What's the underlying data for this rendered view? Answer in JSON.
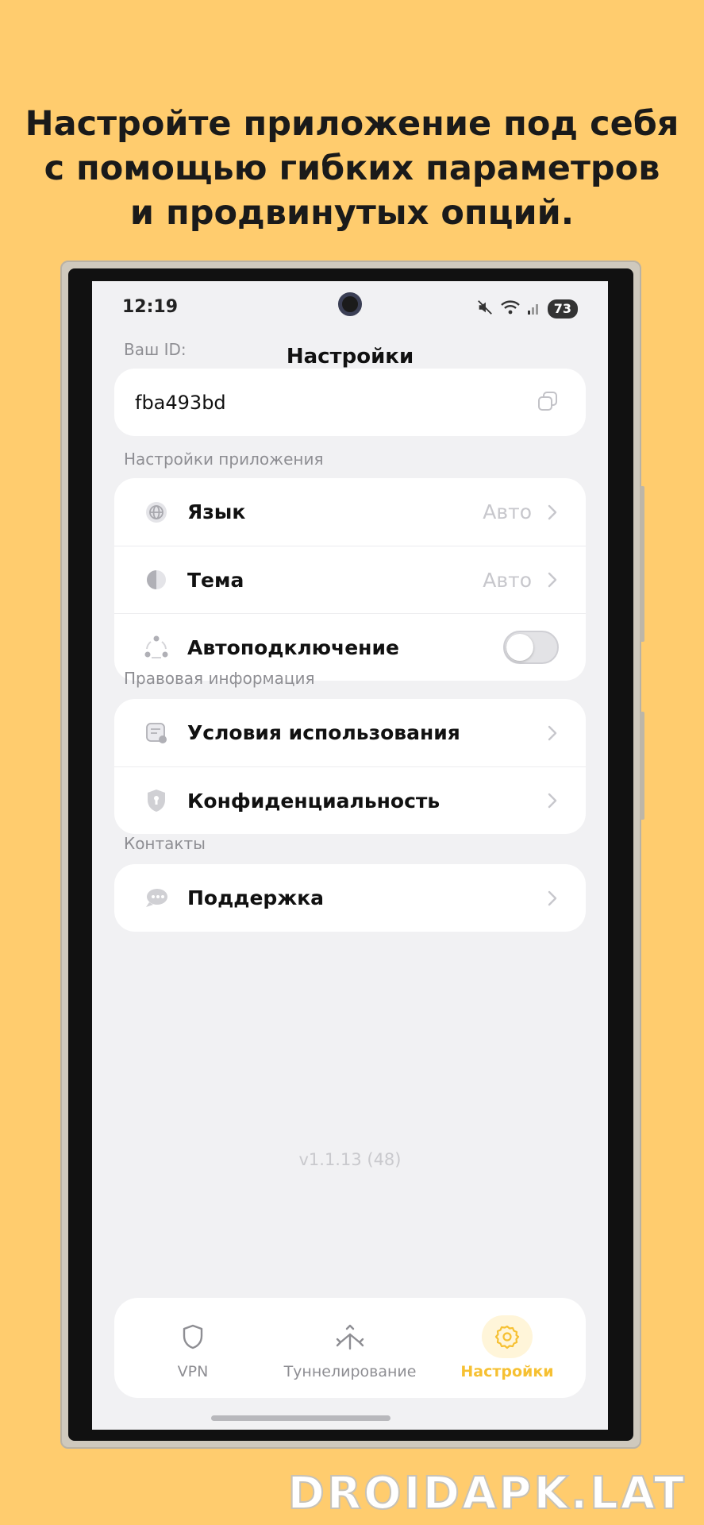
{
  "headline": {
    "line1": "Настройте приложение под себя",
    "line2": "с помощью гибких параметров",
    "line3": "и продвинутых опций."
  },
  "status_bar": {
    "time": "12:19",
    "battery": "73"
  },
  "header": {
    "title": "Настройки"
  },
  "id_section": {
    "label": "Ваш ID:",
    "value": "fba493bd"
  },
  "app_settings": {
    "label": "Настройки приложения",
    "items": [
      {
        "label": "Язык",
        "value": "Авто",
        "icon": "globe-icon"
      },
      {
        "label": "Тема",
        "value": "Авто",
        "icon": "theme-icon"
      },
      {
        "label": "Автоподключение",
        "icon": "auto-connect-icon",
        "toggle_on": false
      }
    ]
  },
  "legal": {
    "label": "Правовая информация",
    "items": [
      {
        "label": "Условия использования",
        "icon": "document-icon"
      },
      {
        "label": "Конфиденциальность",
        "icon": "shield-lock-icon"
      }
    ]
  },
  "contacts": {
    "label": "Контакты",
    "items": [
      {
        "label": "Поддержка",
        "icon": "chat-icon"
      }
    ]
  },
  "version": "v1.1.13 (48)",
  "tabbar": {
    "tabs": [
      {
        "label": "VPN",
        "icon": "shield-icon",
        "active": false
      },
      {
        "label": "Туннелирование",
        "icon": "split-arrows-icon",
        "active": false
      },
      {
        "label": "Настройки",
        "icon": "gear-icon",
        "active": true
      }
    ]
  },
  "colors": {
    "background": "#FFCC6E",
    "accent": "#F6C032",
    "screen": "#F1F1F3"
  },
  "watermark": "DROIDAPK.LAT"
}
